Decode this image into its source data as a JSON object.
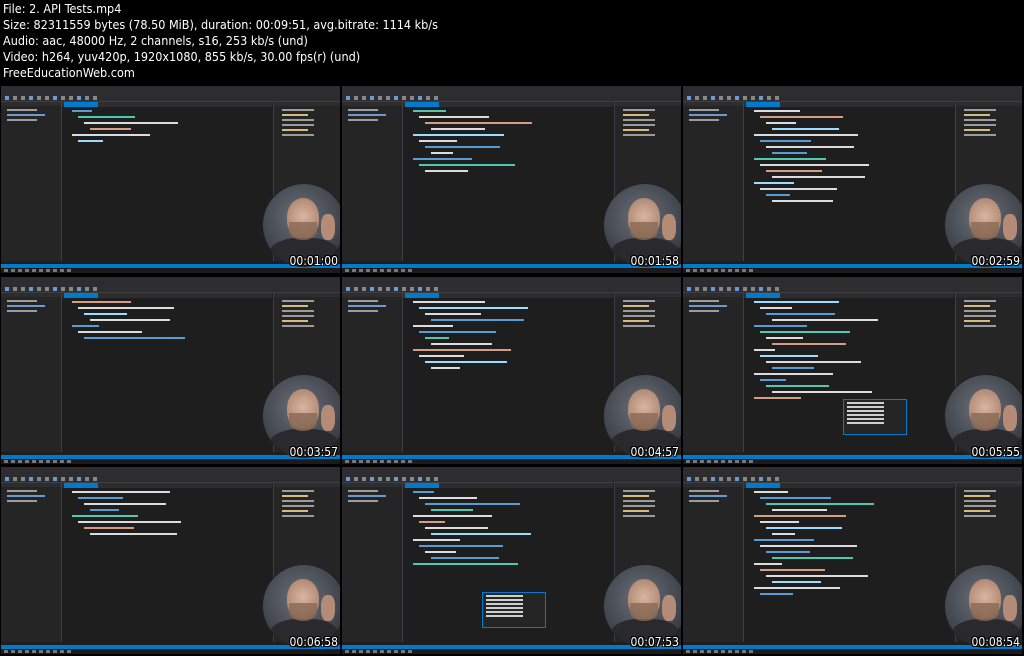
{
  "header": {
    "file": "File: 2. API Tests.mp4",
    "size": "Size: 82311559 bytes (78.50 MiB), duration: 00:09:51, avg.bitrate: 1114 kb/s",
    "audio": "Audio: aac, 48000 Hz, 2 channels, s16, 253 kb/s (und)",
    "video": "Video: h264, yuv420p, 1920x1080, 855 kb/s, 30.00 fps(r) (und)",
    "site": "FreeEducationWeb.com"
  },
  "thumbnails": [
    {
      "timestamp": "00:01:00"
    },
    {
      "timestamp": "00:01:58"
    },
    {
      "timestamp": "00:02:59"
    },
    {
      "timestamp": "00:03:57"
    },
    {
      "timestamp": "00:04:57"
    },
    {
      "timestamp": "00:05:55"
    },
    {
      "timestamp": "00:06:58"
    },
    {
      "timestamp": "00:07:53"
    },
    {
      "timestamp": "00:08:54"
    }
  ],
  "colors": {
    "background": "#000000",
    "ide_bg": "#1e1e1e",
    "ide_panel": "#252526",
    "accent_blue": "#007acc",
    "code_keyword": "#569cd6",
    "code_type": "#4ec9b0",
    "code_string": "#d69d85",
    "code_text": "#dcdcdc"
  }
}
